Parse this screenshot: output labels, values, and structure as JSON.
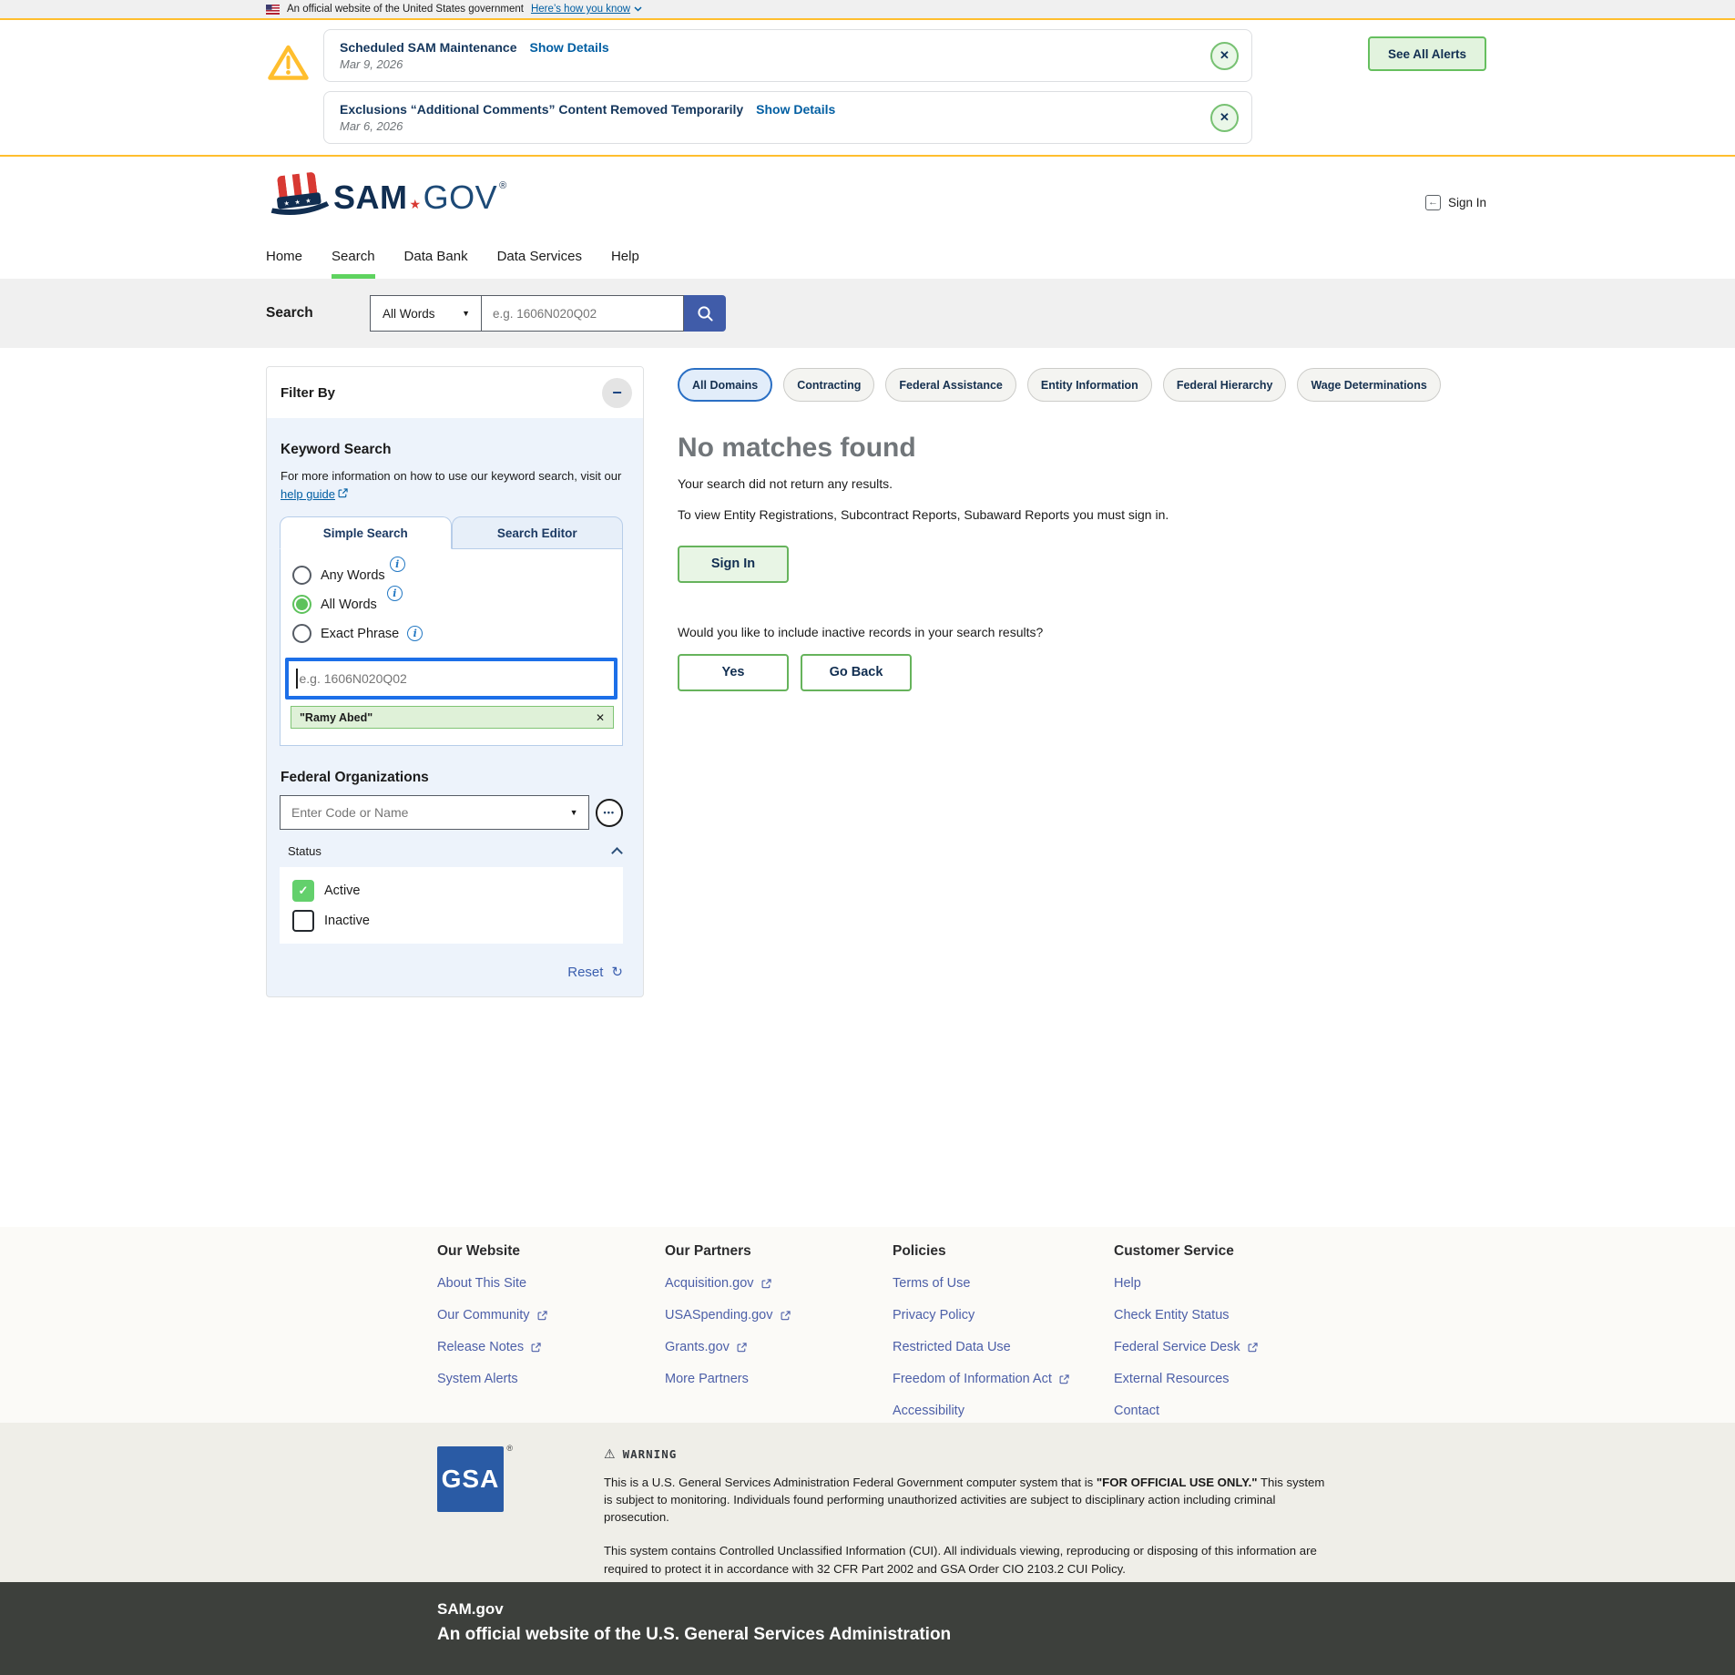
{
  "colors": {
    "gold_accent": "#ffbe2e",
    "link_blue": "#005ea2",
    "navy": "#112e51",
    "green_accent": "#66bf5f",
    "green_fill_light": "#e8f5e5",
    "search_button_blue": "#405ca9",
    "focus_input_blue": "#1c6fe8",
    "panel_blue_bg": "#edf3fb",
    "footer_link_indigo": "#4c5fa8",
    "dark_footer_bg": "#3d403c",
    "gsa_blue": "#2a5ba5",
    "heading_gray": "#71767a"
  },
  "icons": {
    "close": "✕",
    "minus": "−",
    "ellipsis": "•••",
    "caret_down": "▼",
    "arrow_left": "←",
    "check": "✓",
    "refresh": "↻",
    "info": "i",
    "warning": "⚠",
    "reg": "®",
    "star": "★"
  },
  "banner": {
    "text": "An official website of the United States government",
    "link": "Here’s how you know"
  },
  "alerts": {
    "items": [
      {
        "title": "Scheduled SAM Maintenance",
        "link": "Show Details",
        "date": "Mar 9, 2026"
      },
      {
        "title": "Exclusions “Additional Comments” Content Removed Temporarily",
        "link": "Show Details",
        "date": "Mar 6, 2026"
      }
    ],
    "see_all_label": "See All Alerts"
  },
  "header": {
    "logo_sam": "SAM",
    "logo_gov": "GOV",
    "sign_in": "Sign In"
  },
  "nav": {
    "items": [
      {
        "label": "Home",
        "active": false
      },
      {
        "label": "Search",
        "active": true
      },
      {
        "label": "Data Bank",
        "active": false
      },
      {
        "label": "Data Services",
        "active": false
      },
      {
        "label": "Help",
        "active": false
      }
    ]
  },
  "searchbar": {
    "label": "Search",
    "scope_value": "All Words",
    "placeholder": "e.g. 1606N020Q02"
  },
  "filter": {
    "title": "Filter By",
    "keyword": {
      "heading": "Keyword Search",
      "description": "For more information on how to use our keyword search, visit our",
      "help_link": "help guide",
      "tabs": [
        {
          "label": "Simple Search",
          "active": true
        },
        {
          "label": "Search Editor",
          "active": false
        }
      ],
      "options": [
        {
          "label": "Any Words",
          "selected": false
        },
        {
          "label": "All Words",
          "selected": true
        },
        {
          "label": "Exact Phrase",
          "selected": false
        }
      ],
      "input_placeholder": "e.g. 1606N020Q02",
      "chip_label": "\"Ramy Abed\""
    },
    "federal_orgs": {
      "heading": "Federal Organizations",
      "placeholder": "Enter Code or Name"
    },
    "status": {
      "label": "Status",
      "options": [
        {
          "label": "Active",
          "checked": true
        },
        {
          "label": "Inactive",
          "checked": false
        }
      ]
    },
    "reset_label": "Reset"
  },
  "results": {
    "domains": [
      {
        "label": "All Domains",
        "active": true
      },
      {
        "label": "Contracting",
        "active": false
      },
      {
        "label": "Federal Assistance",
        "active": false
      },
      {
        "label": "Entity Information",
        "active": false
      },
      {
        "label": "Federal Hierarchy",
        "active": false
      },
      {
        "label": "Wage Determinations",
        "active": false
      }
    ],
    "heading": "No matches found",
    "message1": "Your search did not return any results.",
    "message2": "To view Entity Registrations, Subcontract Reports, Subaward Reports you must sign in.",
    "sign_in_label": "Sign In",
    "question": "Would you like to include inactive records in your search results?",
    "yes_label": "Yes",
    "go_back_label": "Go Back"
  },
  "footer": {
    "columns": [
      {
        "heading": "Our Website",
        "links": [
          {
            "label": "About This Site",
            "external": false
          },
          {
            "label": "Our Community",
            "external": true
          },
          {
            "label": "Release Notes",
            "external": true
          },
          {
            "label": "System Alerts",
            "external": false
          }
        ]
      },
      {
        "heading": "Our Partners",
        "links": [
          {
            "label": "Acquisition.gov",
            "external": true
          },
          {
            "label": "USASpending.gov",
            "external": true
          },
          {
            "label": "Grants.gov",
            "external": true
          },
          {
            "label": "More Partners",
            "external": false
          }
        ]
      },
      {
        "heading": "Policies",
        "links": [
          {
            "label": "Terms of Use",
            "external": false
          },
          {
            "label": "Privacy Policy",
            "external": false
          },
          {
            "label": "Restricted Data Use",
            "external": false
          },
          {
            "label": "Freedom of Information Act",
            "external": true
          },
          {
            "label": "Accessibility",
            "external": false
          }
        ]
      },
      {
        "heading": "Customer Service",
        "links": [
          {
            "label": "Help",
            "external": false
          },
          {
            "label": "Check Entity Status",
            "external": false
          },
          {
            "label": "Federal Service Desk",
            "external": true
          },
          {
            "label": "External Resources",
            "external": false
          },
          {
            "label": "Contact",
            "external": false
          }
        ]
      }
    ],
    "gsa_label": "GSA",
    "warning_title": "WARNING",
    "warning_p1_a": "This is a U.S. General Services Administration Federal Government computer system that is ",
    "warning_p1_b": "\"FOR OFFICIAL USE ONLY.\"",
    "warning_p1_c": " This system is subject to monitoring. Individuals found performing unauthorized activities are subject to disciplinary action including criminal prosecution.",
    "warning_p2": "This system contains Controlled Unclassified Information (CUI). All individuals viewing, reproducing or disposing of this information are required to protect it in accordance with 32 CFR Part 2002 and GSA Order CIO 2103.2 CUI Policy.",
    "site": "SAM.gov",
    "official": "An official website of the U.S. General Services Administration"
  }
}
